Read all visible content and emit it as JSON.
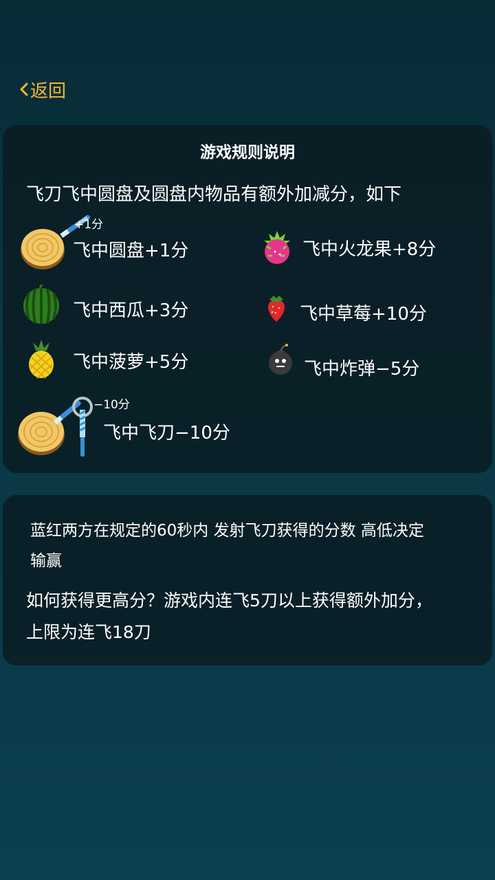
{
  "nav": {
    "back_label": "返回"
  },
  "rules": {
    "title": "游戏规则说明",
    "intro": "飞刀飞中圆盘及圆盘内物品有额外加减分，如下",
    "items": [
      {
        "label": "飞中圆盘+1分",
        "icon": "wood-disc-icon"
      },
      {
        "label": "飞中火龙果+8分",
        "icon": "dragon-fruit-icon"
      },
      {
        "label": "飞中西瓜+3分",
        "icon": "watermelon-icon"
      },
      {
        "label": "飞中草莓+10分",
        "icon": "strawberry-icon"
      },
      {
        "label": "飞中菠萝+5分",
        "icon": "pineapple-icon"
      },
      {
        "label": "飞中炸弹−5分",
        "icon": "bomb-icon"
      },
      {
        "label": "飞中飞刀−10分",
        "icon": "knife-icon"
      }
    ],
    "disc_bonus": "+1分",
    "knife_penalty": "−10分"
  },
  "info": {
    "line1": "蓝红两方在规定的60秒内 发射飞刀获得的分数 高低决定",
    "line2": "输赢",
    "line3": "如何获得更高分？游戏内连飞5刀以上获得额外加分，",
    "line4": "上限为连飞18刀"
  },
  "colors": {
    "accent": "#f5b731",
    "card_bg": "rgba(10,26,32,0.78)",
    "background": "#0a3440"
  }
}
